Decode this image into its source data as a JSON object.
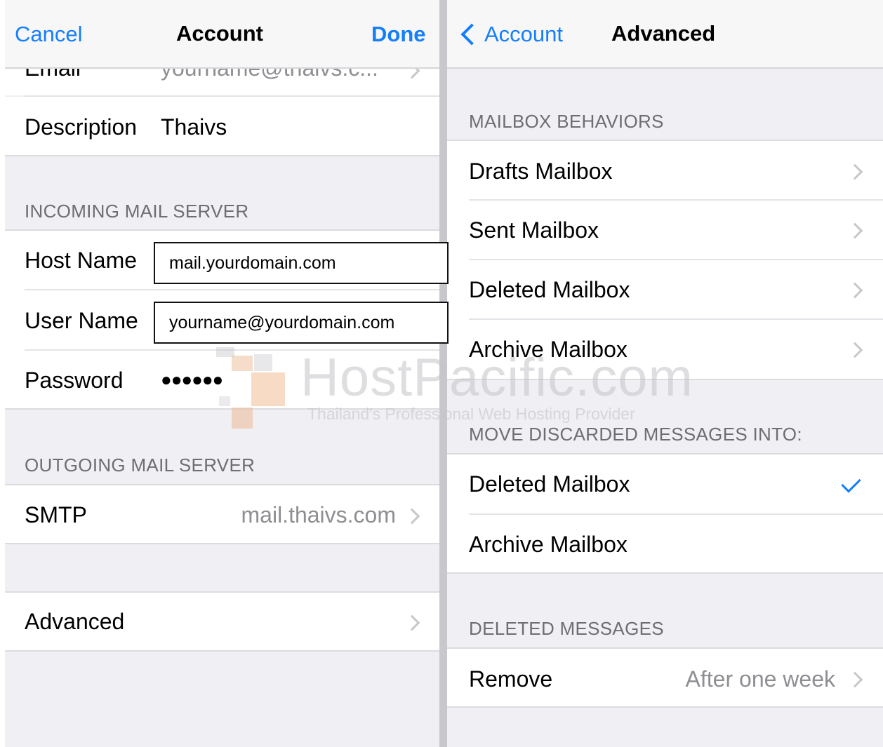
{
  "left": {
    "nav": {
      "cancel": "Cancel",
      "title": "Account",
      "done": "Done"
    },
    "email": {
      "label": "Email",
      "value": "yourname@thaivs.c..."
    },
    "description": {
      "label": "Description",
      "value": "Thaivs"
    },
    "incoming": {
      "header": "INCOMING MAIL SERVER",
      "host_label": "Host Name",
      "host_value": "mail.yourdomain.com",
      "user_label": "User Name",
      "user_value": "yourname@yourdomain.com",
      "password_label": "Password",
      "password_value": "●●●●●●"
    },
    "outgoing": {
      "header": "OUTGOING MAIL SERVER",
      "smtp_label": "SMTP",
      "smtp_value": "mail.thaivs.com"
    },
    "advanced_label": "Advanced"
  },
  "right": {
    "nav": {
      "back": "Account",
      "title": "Advanced"
    },
    "mailbox_behaviors": {
      "header": "MAILBOX BEHAVIORS",
      "items": [
        "Drafts Mailbox",
        "Sent Mailbox",
        "Deleted Mailbox",
        "Archive Mailbox"
      ]
    },
    "move_discarded": {
      "header": "MOVE DISCARDED MESSAGES INTO:",
      "items": [
        "Deleted Mailbox",
        "Archive Mailbox"
      ],
      "selected": "Deleted Mailbox"
    },
    "deleted_messages": {
      "header": "DELETED MESSAGES",
      "remove_label": "Remove",
      "remove_value": "After one week"
    }
  },
  "watermark": {
    "title": "HostPacific.com",
    "subtitle": "Thailand's Professional Web Hosting Provider"
  },
  "colors": {
    "accent": "#157efb",
    "group_background": "#efeff4",
    "secondary_text": "#8e8e93",
    "chevron": "#c7c7cc"
  }
}
